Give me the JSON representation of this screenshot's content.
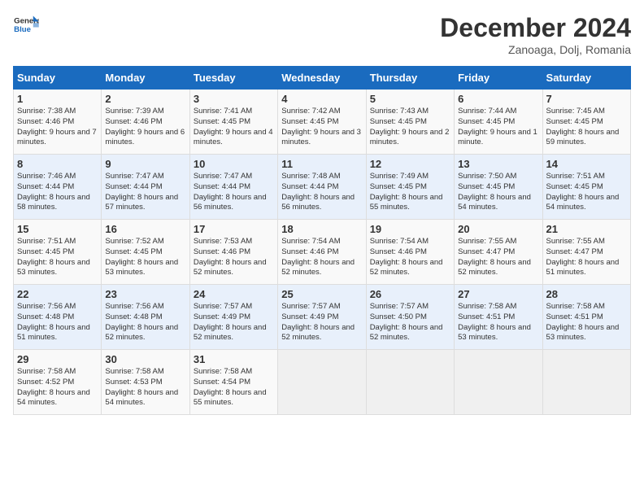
{
  "header": {
    "logo_line1": "General",
    "logo_line2": "Blue",
    "month": "December 2024",
    "location": "Zanoaga, Dolj, Romania"
  },
  "days_of_week": [
    "Sunday",
    "Monday",
    "Tuesday",
    "Wednesday",
    "Thursday",
    "Friday",
    "Saturday"
  ],
  "weeks": [
    [
      {
        "day": "1",
        "text": "Sunrise: 7:38 AM\nSunset: 4:46 PM\nDaylight: 9 hours and 7 minutes."
      },
      {
        "day": "2",
        "text": "Sunrise: 7:39 AM\nSunset: 4:46 PM\nDaylight: 9 hours and 6 minutes."
      },
      {
        "day": "3",
        "text": "Sunrise: 7:41 AM\nSunset: 4:45 PM\nDaylight: 9 hours and 4 minutes."
      },
      {
        "day": "4",
        "text": "Sunrise: 7:42 AM\nSunset: 4:45 PM\nDaylight: 9 hours and 3 minutes."
      },
      {
        "day": "5",
        "text": "Sunrise: 7:43 AM\nSunset: 4:45 PM\nDaylight: 9 hours and 2 minutes."
      },
      {
        "day": "6",
        "text": "Sunrise: 7:44 AM\nSunset: 4:45 PM\nDaylight: 9 hours and 1 minute."
      },
      {
        "day": "7",
        "text": "Sunrise: 7:45 AM\nSunset: 4:45 PM\nDaylight: 8 hours and 59 minutes."
      }
    ],
    [
      {
        "day": "8",
        "text": "Sunrise: 7:46 AM\nSunset: 4:44 PM\nDaylight: 8 hours and 58 minutes."
      },
      {
        "day": "9",
        "text": "Sunrise: 7:47 AM\nSunset: 4:44 PM\nDaylight: 8 hours and 57 minutes."
      },
      {
        "day": "10",
        "text": "Sunrise: 7:47 AM\nSunset: 4:44 PM\nDaylight: 8 hours and 56 minutes."
      },
      {
        "day": "11",
        "text": "Sunrise: 7:48 AM\nSunset: 4:44 PM\nDaylight: 8 hours and 56 minutes."
      },
      {
        "day": "12",
        "text": "Sunrise: 7:49 AM\nSunset: 4:45 PM\nDaylight: 8 hours and 55 minutes."
      },
      {
        "day": "13",
        "text": "Sunrise: 7:50 AM\nSunset: 4:45 PM\nDaylight: 8 hours and 54 minutes."
      },
      {
        "day": "14",
        "text": "Sunrise: 7:51 AM\nSunset: 4:45 PM\nDaylight: 8 hours and 54 minutes."
      }
    ],
    [
      {
        "day": "15",
        "text": "Sunrise: 7:51 AM\nSunset: 4:45 PM\nDaylight: 8 hours and 53 minutes."
      },
      {
        "day": "16",
        "text": "Sunrise: 7:52 AM\nSunset: 4:45 PM\nDaylight: 8 hours and 53 minutes."
      },
      {
        "day": "17",
        "text": "Sunrise: 7:53 AM\nSunset: 4:46 PM\nDaylight: 8 hours and 52 minutes."
      },
      {
        "day": "18",
        "text": "Sunrise: 7:54 AM\nSunset: 4:46 PM\nDaylight: 8 hours and 52 minutes."
      },
      {
        "day": "19",
        "text": "Sunrise: 7:54 AM\nSunset: 4:46 PM\nDaylight: 8 hours and 52 minutes."
      },
      {
        "day": "20",
        "text": "Sunrise: 7:55 AM\nSunset: 4:47 PM\nDaylight: 8 hours and 52 minutes."
      },
      {
        "day": "21",
        "text": "Sunrise: 7:55 AM\nSunset: 4:47 PM\nDaylight: 8 hours and 51 minutes."
      }
    ],
    [
      {
        "day": "22",
        "text": "Sunrise: 7:56 AM\nSunset: 4:48 PM\nDaylight: 8 hours and 51 minutes."
      },
      {
        "day": "23",
        "text": "Sunrise: 7:56 AM\nSunset: 4:48 PM\nDaylight: 8 hours and 52 minutes."
      },
      {
        "day": "24",
        "text": "Sunrise: 7:57 AM\nSunset: 4:49 PM\nDaylight: 8 hours and 52 minutes."
      },
      {
        "day": "25",
        "text": "Sunrise: 7:57 AM\nSunset: 4:49 PM\nDaylight: 8 hours and 52 minutes."
      },
      {
        "day": "26",
        "text": "Sunrise: 7:57 AM\nSunset: 4:50 PM\nDaylight: 8 hours and 52 minutes."
      },
      {
        "day": "27",
        "text": "Sunrise: 7:58 AM\nSunset: 4:51 PM\nDaylight: 8 hours and 53 minutes."
      },
      {
        "day": "28",
        "text": "Sunrise: 7:58 AM\nSunset: 4:51 PM\nDaylight: 8 hours and 53 minutes."
      }
    ],
    [
      {
        "day": "29",
        "text": "Sunrise: 7:58 AM\nSunset: 4:52 PM\nDaylight: 8 hours and 54 minutes."
      },
      {
        "day": "30",
        "text": "Sunrise: 7:58 AM\nSunset: 4:53 PM\nDaylight: 8 hours and 54 minutes."
      },
      {
        "day": "31",
        "text": "Sunrise: 7:58 AM\nSunset: 4:54 PM\nDaylight: 8 hours and 55 minutes."
      },
      {
        "day": "",
        "text": ""
      },
      {
        "day": "",
        "text": ""
      },
      {
        "day": "",
        "text": ""
      },
      {
        "day": "",
        "text": ""
      }
    ]
  ]
}
